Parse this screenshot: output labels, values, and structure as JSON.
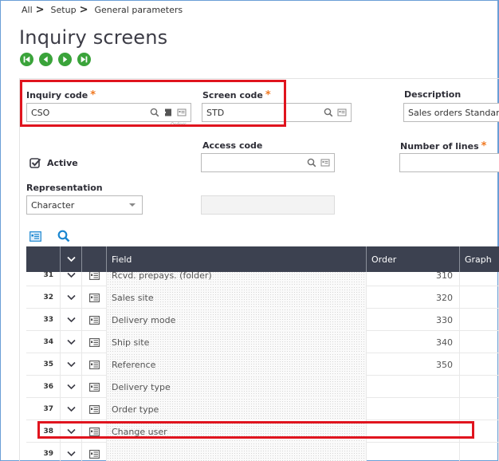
{
  "breadcrumb": {
    "items": [
      "All",
      "Setup",
      "General parameters"
    ],
    "separator": ">"
  },
  "page": {
    "title": "Inquiry screens"
  },
  "nav_buttons": [
    {
      "name": "first-record",
      "icon": "first-icon"
    },
    {
      "name": "previous-record",
      "icon": "previous-icon"
    },
    {
      "name": "next-record",
      "icon": "next-icon"
    },
    {
      "name": "last-record",
      "icon": "last-icon"
    }
  ],
  "form": {
    "inquiry_code": {
      "label": "Inquiry code",
      "required": "*",
      "value": "CSO",
      "hint": "Orders"
    },
    "screen_code": {
      "label": "Screen code",
      "required": "*",
      "value": "STD"
    },
    "description": {
      "label": "Description",
      "value": "Sales orders Standard"
    },
    "active": {
      "label": "Active",
      "checked": true
    },
    "access_code": {
      "label": "Access code",
      "value": ""
    },
    "number_of_lines": {
      "label": "Number of lines",
      "required": "*",
      "value": ""
    },
    "representation": {
      "label": "Representation",
      "value": "Character"
    },
    "representation_extra": {
      "value": ""
    }
  },
  "grid": {
    "columns": [
      "",
      "",
      "",
      "Field",
      "Order",
      "Graph"
    ],
    "rows": [
      {
        "num": "31",
        "field": "Rcvd. prepays. (folder)",
        "order": "310",
        "graph": ""
      },
      {
        "num": "32",
        "field": "Sales site",
        "order": "320",
        "graph": ""
      },
      {
        "num": "33",
        "field": "Delivery mode",
        "order": "330",
        "graph": ""
      },
      {
        "num": "34",
        "field": "Ship site",
        "order": "340",
        "graph": ""
      },
      {
        "num": "35",
        "field": "Reference",
        "order": "350",
        "graph": ""
      },
      {
        "num": "36",
        "field": "Delivery type",
        "order": "",
        "graph": ""
      },
      {
        "num": "37",
        "field": "Order type",
        "order": "",
        "graph": ""
      },
      {
        "num": "38",
        "field": "Change user",
        "order": "",
        "graph": ""
      },
      {
        "num": "39",
        "field": "",
        "order": "",
        "graph": ""
      }
    ]
  },
  "colors": {
    "accent_green": "#3aa33a",
    "grid_header": "#3c4150",
    "highlight_red": "#e0141e",
    "required_orange": "#f07820",
    "icon_blue": "#1a86d0"
  }
}
